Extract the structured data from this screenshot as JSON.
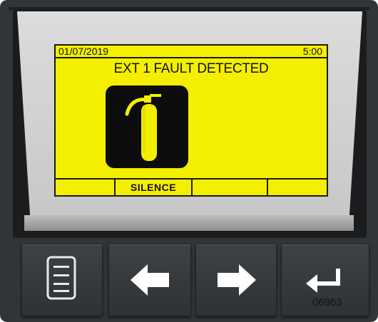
{
  "lcd": {
    "date": "01/07/2019",
    "time": "5:00",
    "message": "EXT 1 FAULT DETECTED",
    "softkeys": [
      "",
      "SILENCE",
      "",
      ""
    ],
    "background_color": "#f4ef00"
  },
  "buttons": {
    "menu_icon": "menu-icon",
    "left_icon": "arrow-left-icon",
    "right_icon": "arrow-right-icon",
    "enter_icon": "enter-icon"
  },
  "code": "06963"
}
